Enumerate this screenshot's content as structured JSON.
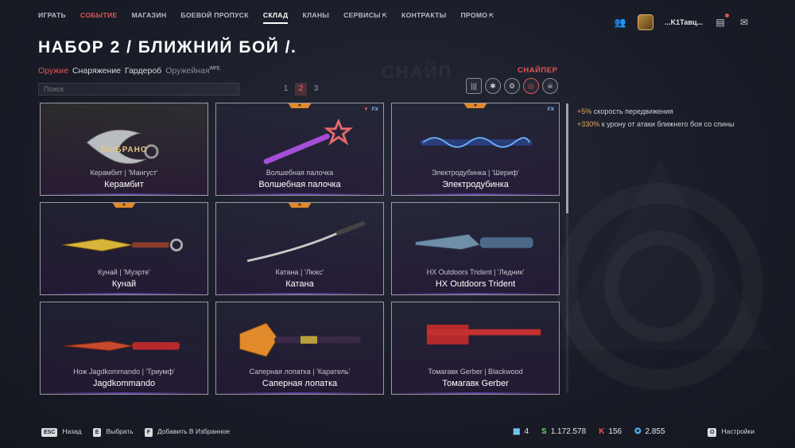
{
  "nav": {
    "items": [
      {
        "label": "ИГРАТЬ",
        "style": "normal"
      },
      {
        "label": "СОБЫТИЕ",
        "style": "accent"
      },
      {
        "label": "МАГАЗИН",
        "style": "normal"
      },
      {
        "label": "БОЕВОЙ ПРОПУСК",
        "style": "normal"
      },
      {
        "label": "СКЛАД",
        "style": "active"
      },
      {
        "label": "КЛАНЫ",
        "style": "normal"
      },
      {
        "label": "СЕРВИСЫ",
        "style": "normal",
        "external": true
      },
      {
        "label": "КОНТРАКТЫ",
        "style": "normal"
      },
      {
        "label": "ПРОМО",
        "style": "normal",
        "external": true
      }
    ],
    "external_icon": "⇱"
  },
  "user": {
    "name": "...K1Тавц..."
  },
  "page_title": "НАБОР 2 / БЛИЖНИЙ БОЙ /.",
  "subnav": {
    "items": [
      "Оружие",
      "Снаряжение",
      "Гардероб",
      "Оружейная"
    ],
    "badge": "WFE"
  },
  "class_label": "СНАЙПЕР",
  "background_class": "СНАЙП",
  "search": {
    "placeholder": "Поиск",
    "value": ""
  },
  "pages": [
    "1",
    "2",
    "3"
  ],
  "current_page": "2",
  "filters": [
    "ammo-icon",
    "medic-icon",
    "engineer-icon",
    "sniper-icon",
    "skull-icon"
  ],
  "active_filter": "sniper-icon",
  "cards": [
    {
      "subname": "Керамбит | 'Мангуст'",
      "name": "Керамбит",
      "selected": true,
      "selected_label": "ВЫБРАНО",
      "rarity": false,
      "fx": false,
      "weapon": "karambit"
    },
    {
      "subname": "Волшебная палочка",
      "name": "Волшебная палочка",
      "selected": false,
      "rarity": true,
      "fx": true,
      "fx_hex": true,
      "weapon": "wand"
    },
    {
      "subname": "Электродубинка | 'Шериф'",
      "name": "Электродубинка",
      "selected": false,
      "rarity": true,
      "fx": true,
      "fx_hex": false,
      "weapon": "baton"
    },
    {
      "subname": "Кунай | 'Муэрте'",
      "name": "Кунай",
      "selected": false,
      "rarity": true,
      "fx": false,
      "weapon": "kunai"
    },
    {
      "subname": "Катана | 'Люкс'",
      "name": "Катана",
      "selected": false,
      "rarity": true,
      "fx": false,
      "weapon": "katana"
    },
    {
      "subname": "HX Outdoors Trident | 'Ледник'",
      "name": "HX Outdoors Trident",
      "selected": false,
      "rarity": false,
      "fx": false,
      "weapon": "trident"
    },
    {
      "subname": "Нож Jagdkommando | 'Триумф'",
      "name": "Jagdkommando",
      "selected": false,
      "rarity": false,
      "fx": false,
      "weapon": "jagd"
    },
    {
      "subname": "Саперная лопатка | 'Каратель'",
      "name": "Саперная лопатка",
      "selected": false,
      "rarity": false,
      "fx": false,
      "weapon": "shovel"
    },
    {
      "subname": "Томагавк Gerber | Blackwood",
      "name": "Томагавк Gerber",
      "selected": false,
      "rarity": false,
      "fx": false,
      "weapon": "tomahawk"
    }
  ],
  "fx_label": "FX",
  "stats": [
    {
      "value": "+5%",
      "text": "скорость передвижения"
    },
    {
      "value": "+330%",
      "text": "к урону от атаки ближнего боя со спины"
    }
  ],
  "footer": {
    "actions": [
      {
        "key": "ESC",
        "label": "Назад"
      },
      {
        "key": "E",
        "label": "Выбрать"
      },
      {
        "key": "F",
        "label": "Добавить В Избранное"
      }
    ],
    "settings": {
      "key": "O",
      "label": "Настройки"
    }
  },
  "currency": [
    {
      "icon": "boxes-icon",
      "symbol": "▦",
      "value": "4",
      "color": "#7fd0ff"
    },
    {
      "icon": "warbucks-icon",
      "symbol": "S",
      "value": "1.172.578",
      "color": "#6fd36f"
    },
    {
      "icon": "kredits-icon",
      "symbol": "K",
      "value": "156",
      "color": "#e05656"
    },
    {
      "icon": "crowns-icon",
      "symbol": "✪",
      "value": "2.855",
      "color": "#4fb4ff"
    }
  ],
  "colors": {
    "accent": "#e05656",
    "rarity": "#e08a2c",
    "stat_value": "#e8a95a"
  }
}
